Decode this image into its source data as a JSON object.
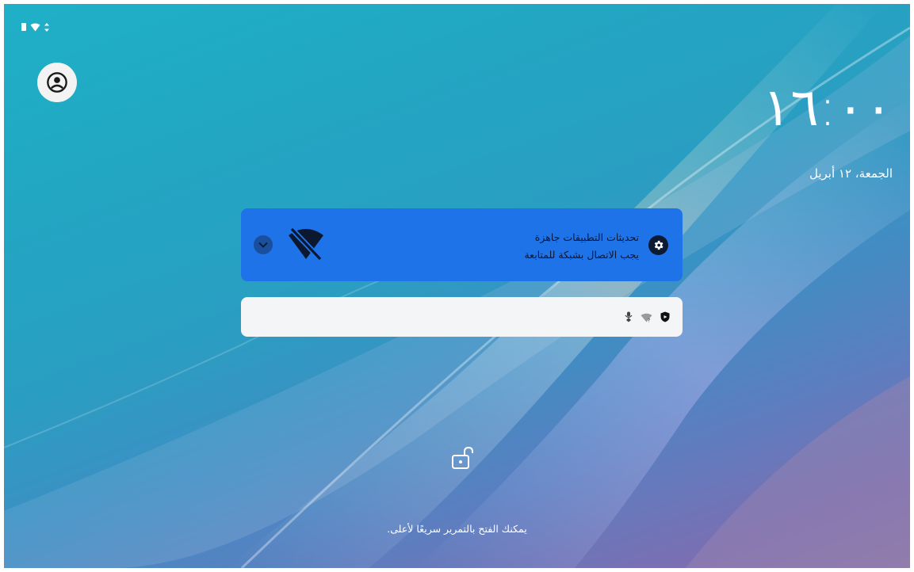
{
  "statusbar": {
    "battery_icon": "battery-icon",
    "wifi_icon": "wifi-icon",
    "data_icon": "data-arrows-icon"
  },
  "lockscreen": {
    "clock": "١٦:٠٠",
    "date": "الجمعة، ١٢ أبريل",
    "unlock_hint": "يمكنك الفتح بالتمرير سريعًا لأعلى."
  },
  "notification": {
    "title": "تحديثات التطبيقات جاهزة",
    "body": "يجب الاتصال بشبكة للمتابعة",
    "icon": "gear-icon",
    "status_icon": "wifi-off-icon",
    "expand_icon": "chevron-down-icon",
    "background_color": "#1f73e8"
  },
  "status_card": {
    "icons": [
      "mic-location-icon",
      "wifi-question-icon",
      "shield-icon"
    ]
  },
  "colors": {
    "accent": "#1f73e8",
    "card": "#f4f5f7",
    "text_dark": "#0c1730"
  }
}
